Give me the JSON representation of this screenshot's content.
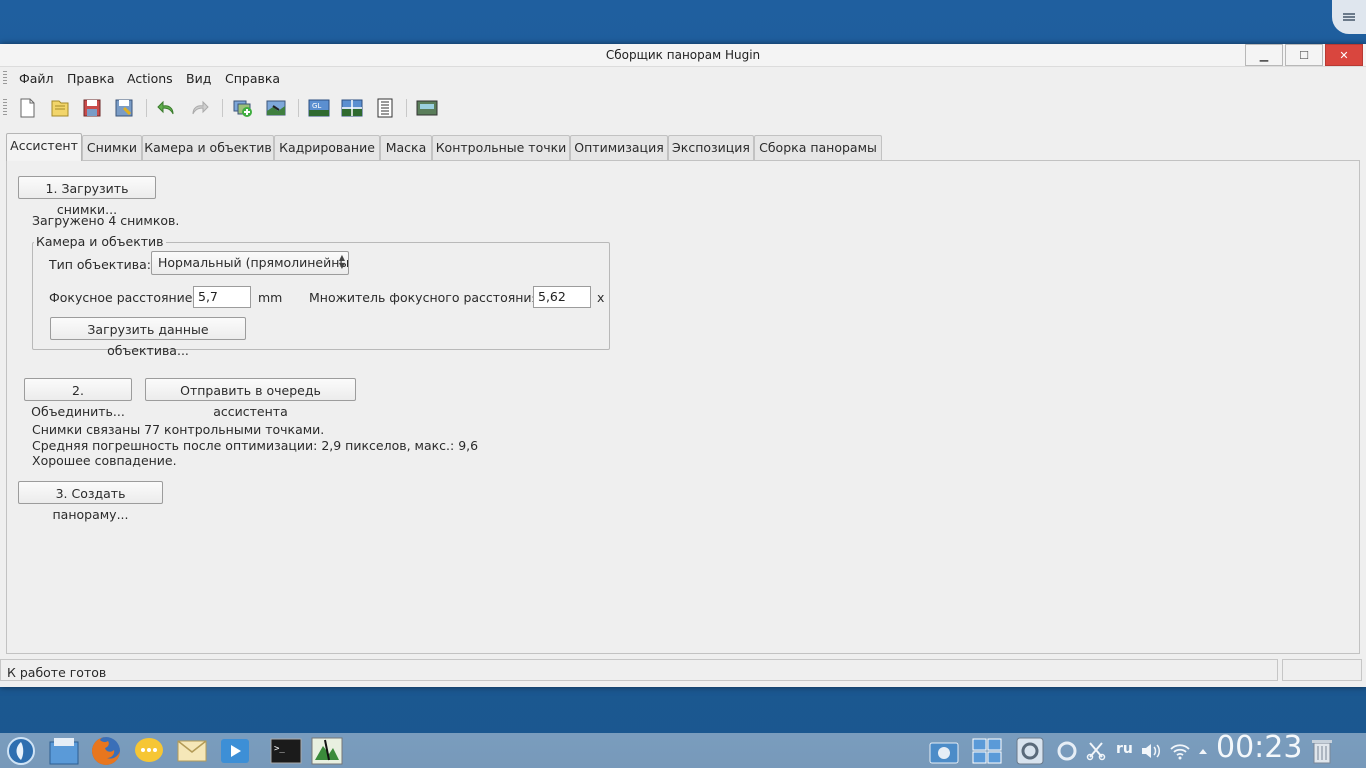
{
  "window": {
    "title": "Сборщик панорам Hugin"
  },
  "menu": {
    "items": [
      "Файл",
      "Правка",
      "Actions",
      "Вид",
      "Справка"
    ]
  },
  "toolbar": {
    "icons": [
      "new-project-icon",
      "open-project-icon",
      "save-icon",
      "save-as-icon",
      "undo-icon",
      "redo-icon",
      "add-images-icon",
      "add-time-series-icon",
      "gl-preview-icon",
      "fast-preview-icon",
      "batch-processor-icon",
      "layout-icon"
    ]
  },
  "tabs": [
    "Ассистент",
    "Снимки",
    "Камера и объектив",
    "Кадрирование",
    "Маска",
    "Контрольные точки",
    "Оптимизация",
    "Экспозиция",
    "Сборка панорамы"
  ],
  "assistant": {
    "load_images_btn": "1. Загрузить снимки...",
    "loaded_text": "Загружено 4 снимков.",
    "camera_group": {
      "title": "Камера и объектив",
      "lens_type_label": "Тип объектива:",
      "lens_type_value": "Нормальный (прямолинейный)",
      "focal_label": "Фокусное расстояние:",
      "focal_value": "5,7",
      "focal_unit": "mm",
      "crop_label": "Множитель фокусного расстояния:",
      "crop_value": "5,62",
      "crop_unit": "x",
      "load_lens_btn": "Загрузить данные объектива..."
    },
    "align_btn": "2. Объединить...",
    "queue_btn": "Отправить в очередь ассистента",
    "status_lines": [
      "Снимки связаны 77 контрольными точками.",
      "Средняя погрешность после оптимизации: 2,9 пикселов, макс.: 9,6",
      "Хорошее совпадение."
    ],
    "create_btn": "3. Создать панораму..."
  },
  "statusbar": {
    "text": "К работе готов"
  },
  "taskbar": {
    "apps": [
      "start-menu-icon",
      "file-manager-icon",
      "firefox-icon",
      "chat-icon",
      "mail-icon",
      "media-player-icon",
      "terminal-icon",
      "hugin-icon"
    ],
    "tray": [
      "screenshot-icon",
      "desktops-icon",
      "settings-icon",
      "update-icon",
      "scissors-icon",
      "volume-icon",
      "wifi-icon",
      "tray-expand-icon",
      "trash-icon"
    ],
    "lang": "ru",
    "clock": "00:23"
  }
}
